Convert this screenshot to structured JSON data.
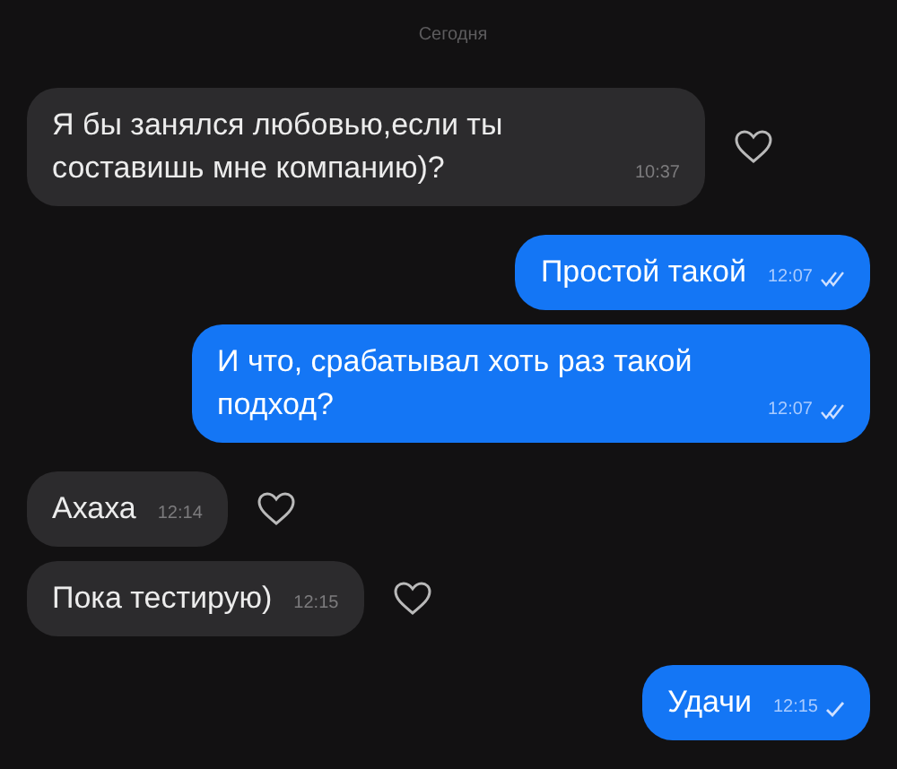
{
  "date_label": "Сегодня",
  "messages": [
    {
      "outgoing": false,
      "text": "Я бы занялся любовью,если ты составишь мне компанию)?",
      "time": "10:37"
    },
    {
      "outgoing": true,
      "text": "Простой такой",
      "time": "12:07",
      "read": true
    },
    {
      "outgoing": true,
      "text": "И что, срабатывал хоть раз такой подход?",
      "time": "12:07",
      "read": true
    },
    {
      "outgoing": false,
      "text": "Ахаха",
      "time": "12:14"
    },
    {
      "outgoing": false,
      "text": "Пока тестирую)",
      "time": "12:15"
    },
    {
      "outgoing": true,
      "text": "Удачи",
      "time": "12:15",
      "read": false
    }
  ]
}
